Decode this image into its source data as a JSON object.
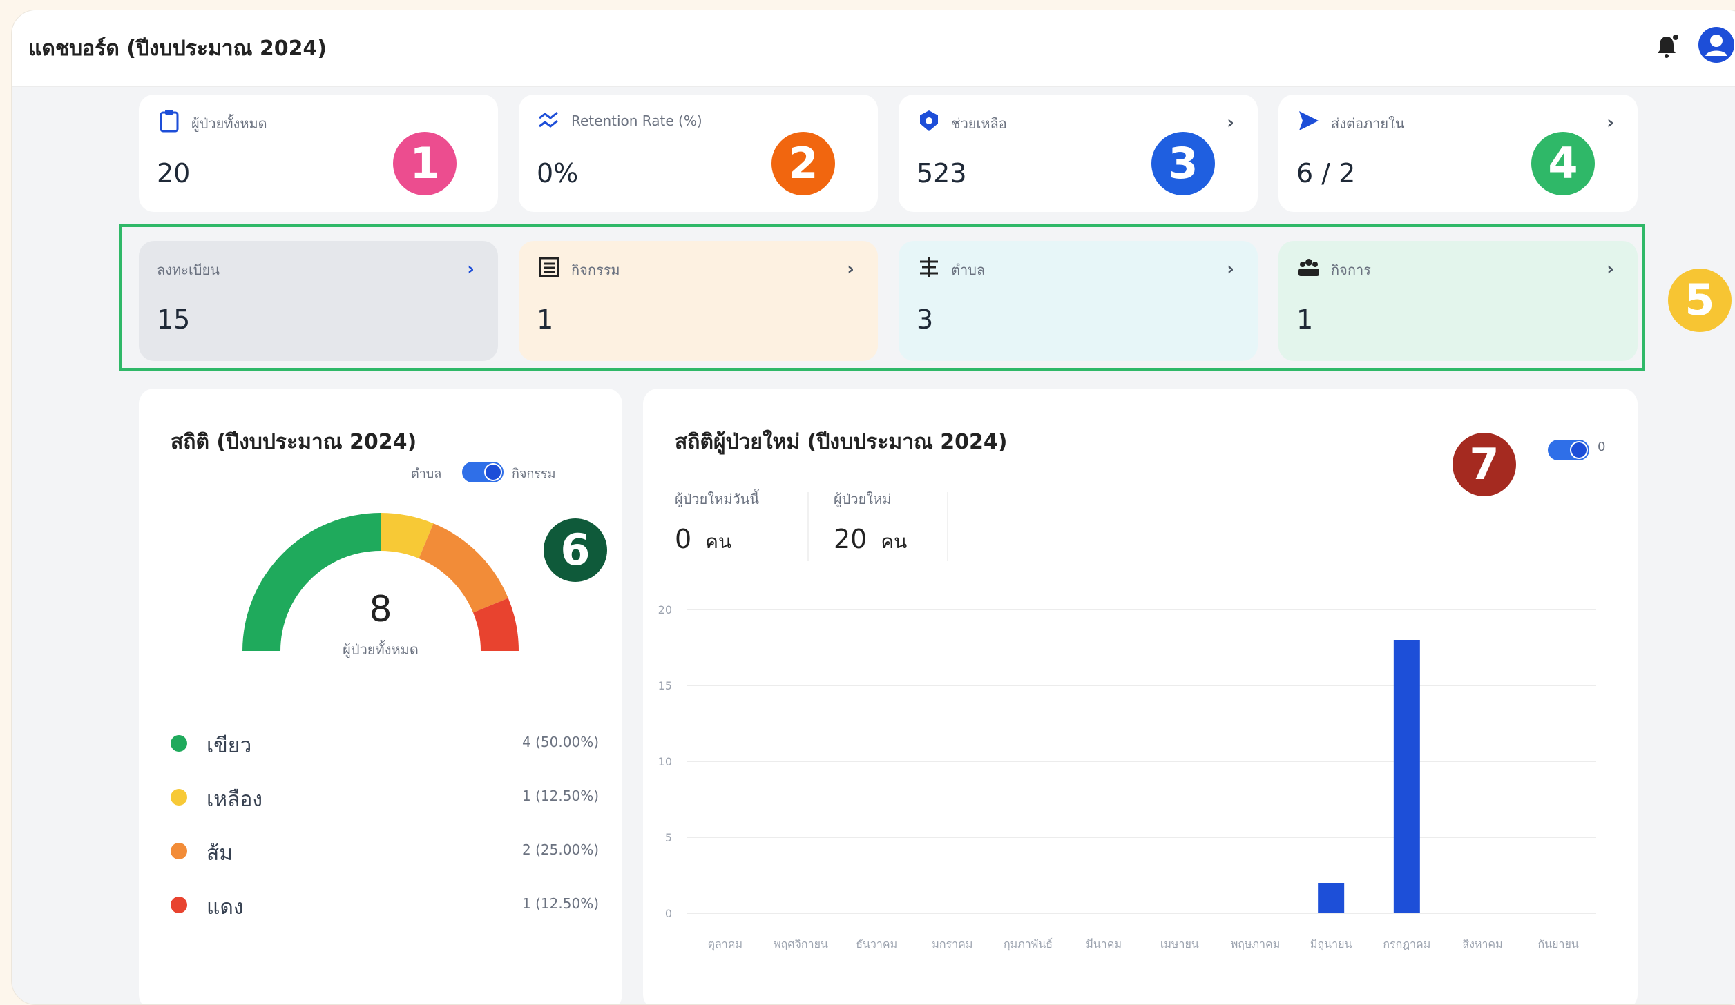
{
  "header": {
    "title": "แดชบอร์ด (ปีงบประมาณ 2024)"
  },
  "stats": [
    {
      "label": "ผู้ป่วยทั้งหมด",
      "value": "20",
      "icon": "clipboard-icon"
    },
    {
      "label": "Retention Rate (%)",
      "value": "0%",
      "icon": "retention-icon"
    },
    {
      "label": "ช่วยเหลือ",
      "value": "523",
      "icon": "badge-icon"
    },
    {
      "label": "ส่งต่อภายใน",
      "value": "6 / 2",
      "icon": "send-icon"
    }
  ],
  "categories": [
    {
      "label": "ลงทะเบียน",
      "value": "15",
      "bg": "#e5e7eb"
    },
    {
      "label": "กิจกรรม",
      "value": "1",
      "bg": "#fdf1e1"
    },
    {
      "label": "ตำบล",
      "value": "3",
      "bg": "#e7f6f8"
    },
    {
      "label": "กิจการ",
      "value": "1",
      "bg": "#e3f5ec"
    }
  ],
  "badges": [
    "1",
    "2",
    "3",
    "4",
    "5",
    "6",
    "7"
  ],
  "badge_colors": [
    "#ec4d8f",
    "#f1660f",
    "#1f5fe0",
    "#2fb868",
    "#f7c533",
    "#0f5a3a",
    "#a52a20"
  ],
  "gauge_panel": {
    "title": "สถิติ (ปีงบประมาณ 2024)",
    "toggle_left": "ตำบล",
    "toggle_right": "กิจกรรม",
    "total": "8",
    "total_label": "ผู้ป่วยทั้งหมด",
    "legend": [
      {
        "name": "เขียว",
        "value": "4 (50.00%)",
        "color": "#1faa5c"
      },
      {
        "name": "เหลือง",
        "value": "1 (12.50%)",
        "color": "#f7c936"
      },
      {
        "name": "ส้ม",
        "value": "2 (25.00%)",
        "color": "#f28c38"
      },
      {
        "name": "แดง",
        "value": "1 (12.50%)",
        "color": "#e8432f"
      }
    ]
  },
  "new_patients": {
    "title": "สถิติผู้ป่วยใหม่ (ปีงบประมาณ 2024)",
    "toggle_label": "0",
    "today_label": "ผู้ป่วยใหม่วันนี้",
    "today_value": "0",
    "total_label": "ผู้ป่วยใหม่",
    "total_value": "20",
    "unit": "คน"
  },
  "chart_data": {
    "type": "bar",
    "categories": [
      "ตุลาคม",
      "พฤศจิกายน",
      "ธันวาคม",
      "มกราคม",
      "กุมภาพันธ์",
      "มีนาคม",
      "เมษายน",
      "พฤษภาคม",
      "มิถุนายน",
      "กรกฎาคม",
      "สิงหาคม",
      "กันยายน"
    ],
    "values": [
      0,
      0,
      0,
      0,
      0,
      0,
      0,
      0,
      2,
      18,
      0,
      0
    ],
    "yticks": [
      "20",
      "15",
      "10",
      "5",
      "0"
    ],
    "ylim": [
      0,
      20
    ],
    "bar_color": "#1d4fd8"
  }
}
